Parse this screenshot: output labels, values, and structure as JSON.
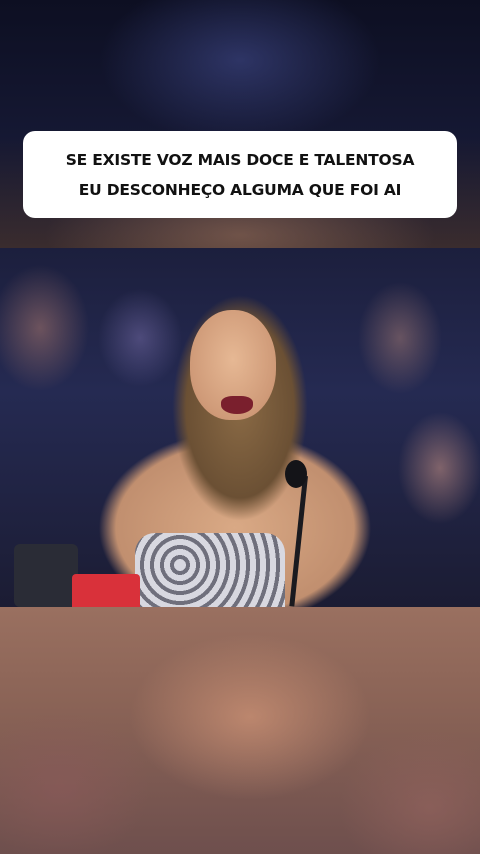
{
  "caption": {
    "line1": "SE EXISTE VOZ MAIS DOCE E TALENTOSA",
    "line2": "EU DESCONHEÇO ALGUMA QUE FOI AI"
  },
  "colors": {
    "caption_background": "#ffffff",
    "caption_text": "#111111",
    "background": "#0b0d1a"
  }
}
